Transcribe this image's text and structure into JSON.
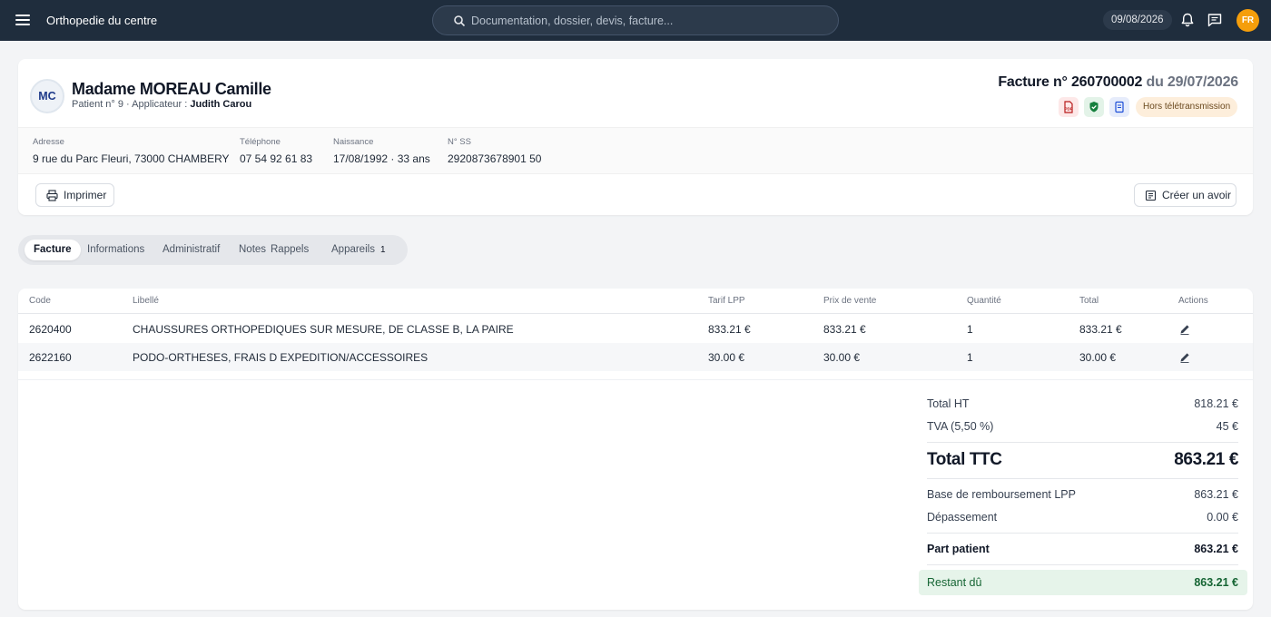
{
  "topbar": {
    "menu_icon": "menu-icon",
    "app_title": "Orthopedie du centre",
    "search_placeholder": "Documentation, dossier, devis, facture...",
    "date": "09/08/2026",
    "user_initials": "FR",
    "icons": [
      "bell-icon",
      "message-icon"
    ]
  },
  "patient": {
    "initials": "MC",
    "name": "Madame MOREAU Camille",
    "sub_prefix": "Patient n° 9 · Applicateur :",
    "applicateur": "Judith Carou"
  },
  "invoice": {
    "title": "Facture n° 260700002",
    "date_part": "du 29/07/2026",
    "status": "Hors télétransmission",
    "icons": [
      "pdf-icon",
      "shield-check-icon",
      "document-icon"
    ]
  },
  "info": {
    "address_label": "Adresse",
    "address": "9 rue du Parc Fleuri, 73000 CHAMBERY",
    "phone_label": "Téléphone",
    "phone": "07 54 92 61 83",
    "birth_label": "Naissance",
    "birth": "17/08/1992 · 33 ans",
    "ss_label": "N° SS",
    "ss": "2920873678901 50"
  },
  "actions": {
    "print": "Imprimer",
    "credit_note": "Créer un avoir"
  },
  "tabs": [
    {
      "label": "Facture"
    },
    {
      "label": "Informations"
    },
    {
      "label": "Administratif"
    },
    {
      "label": "Notes"
    },
    {
      "label": "Rappels"
    },
    {
      "label": "Appareils",
      "count": "1"
    }
  ],
  "table": {
    "headers": [
      "Code",
      "Libellé",
      "Tarif LPP",
      "Prix de vente",
      "Quantité",
      "Total",
      "Actions"
    ],
    "rows": [
      {
        "code": "2620400",
        "label": "CHAUSSURES ORTHOPEDIQUES SUR MESURE, DE CLASSE B, LA PAIRE",
        "tarif": "833.21 €",
        "prix": "833.21 €",
        "qty": "1",
        "total": "833.21 €"
      },
      {
        "code": "2622160",
        "label": "PODO-ORTHESES, FRAIS D EXPEDITION/ACCESSOIRES",
        "tarif": "30.00 €",
        "prix": "30.00 €",
        "qty": "1",
        "total": "30.00 €"
      }
    ]
  },
  "totals": {
    "ht_label": "Total HT",
    "ht": "818.21 €",
    "tva_label": "TVA (5,50 %)",
    "tva": "45 €",
    "ttc_label": "Total TTC",
    "ttc": "863.21 €",
    "base_label": "Base de remboursement LPP",
    "base": "863.21 €",
    "depassement_label": "Dépassement",
    "depassement": "0.00 €",
    "part_label": "Part patient",
    "part": "863.21 €",
    "restant_label": "Restant dû",
    "restant": "863.21 €"
  }
}
